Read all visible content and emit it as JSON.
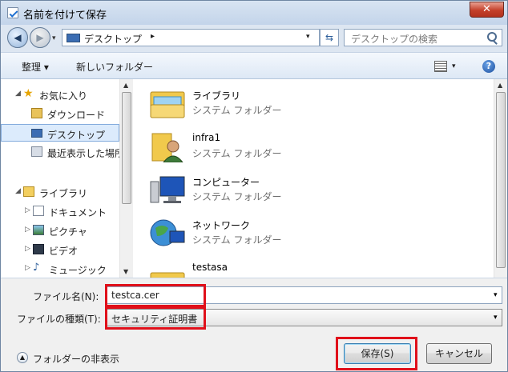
{
  "window": {
    "title": "名前を付けて保存",
    "close_label": "✕"
  },
  "address": {
    "location": "デスクトップ",
    "separator": "▸",
    "search_placeholder": "デスクトップの検索"
  },
  "toolbar": {
    "organize_label": "整理 ▾",
    "new_folder_label": "新しいフォルダー"
  },
  "navigation": {
    "items": [
      {
        "label": "お気に入り"
      },
      {
        "label": "ダウンロード"
      },
      {
        "label": "デスクトップ"
      },
      {
        "label": "最近表示した場所"
      },
      {
        "label": "ライブラリ"
      },
      {
        "label": "ドキュメント"
      },
      {
        "label": "ピクチャ"
      },
      {
        "label": "ビデオ"
      },
      {
        "label": "ミュージック"
      }
    ]
  },
  "files": [
    {
      "name": "ライブラリ",
      "type": "システム フォルダー",
      "icon": "library-folder-icon"
    },
    {
      "name": "infra1",
      "type": "システム フォルダー",
      "icon": "user-folder-icon"
    },
    {
      "name": "コンピューター",
      "type": "システム フォルダー",
      "icon": "computer-icon"
    },
    {
      "name": "ネットワーク",
      "type": "システム フォルダー",
      "icon": "network-icon"
    },
    {
      "name": "testasa",
      "type": "",
      "icon": "folder-icon"
    }
  ],
  "form": {
    "filename_label": "ファイル名(N):",
    "filename_value": "testca.cer",
    "filetype_label": "ファイルの種類(T):",
    "filetype_value": "セキュリティ証明書",
    "hide_folders_label": "フォルダーの非表示",
    "save_label": "保存(S)",
    "cancel_label": "キャンセル"
  },
  "colors": {
    "highlight": "#e0101a",
    "selection": "#dcebfc"
  }
}
